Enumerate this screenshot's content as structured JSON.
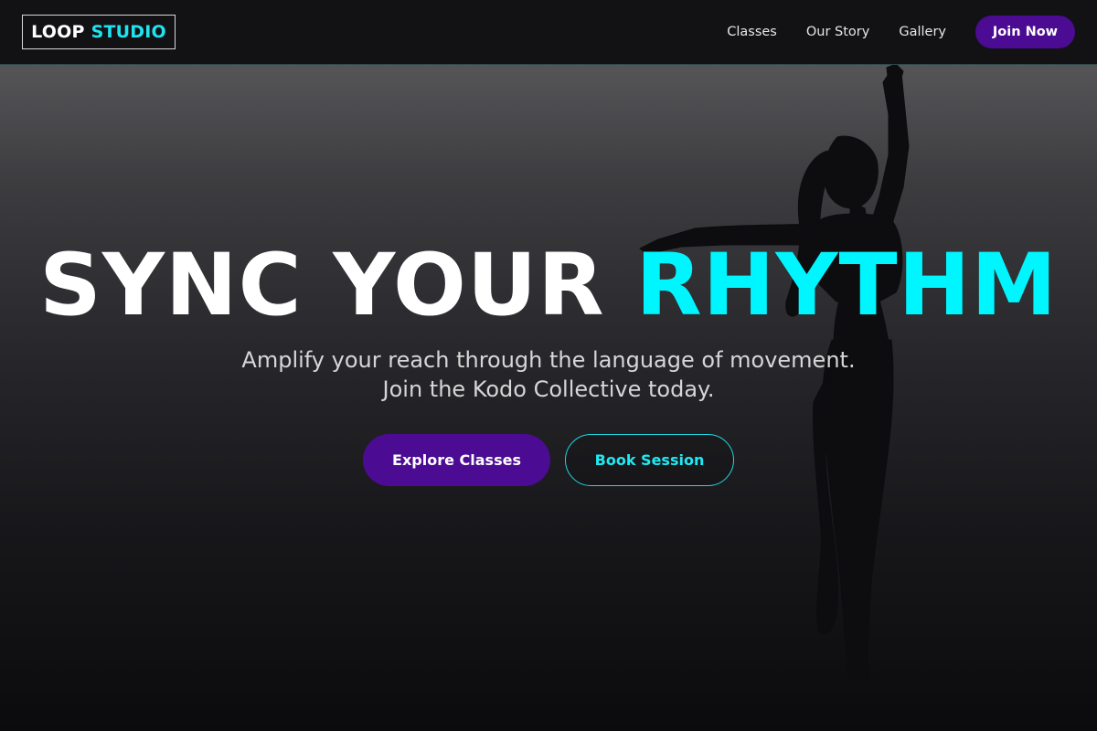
{
  "brand": {
    "logo_word1": "LOOP",
    "logo_word2": "STUDIO"
  },
  "nav": {
    "links": [
      {
        "label": "Classes"
      },
      {
        "label": "Our Story"
      },
      {
        "label": "Gallery"
      }
    ],
    "cta_label": "Join Now"
  },
  "hero": {
    "headline_part1": "SYNC YOUR",
    "headline_part2": "RHYTHM",
    "subtitle_line1": "Amplify your reach through the language of movement.",
    "subtitle_line2": "Join the Kodo Collective today.",
    "primary_button": "Explore Classes",
    "secondary_button": "Book Session"
  },
  "colors": {
    "accent_cyan": "#00f6ff",
    "accent_purple": "#4b0b92",
    "nav_background": "#121215"
  }
}
